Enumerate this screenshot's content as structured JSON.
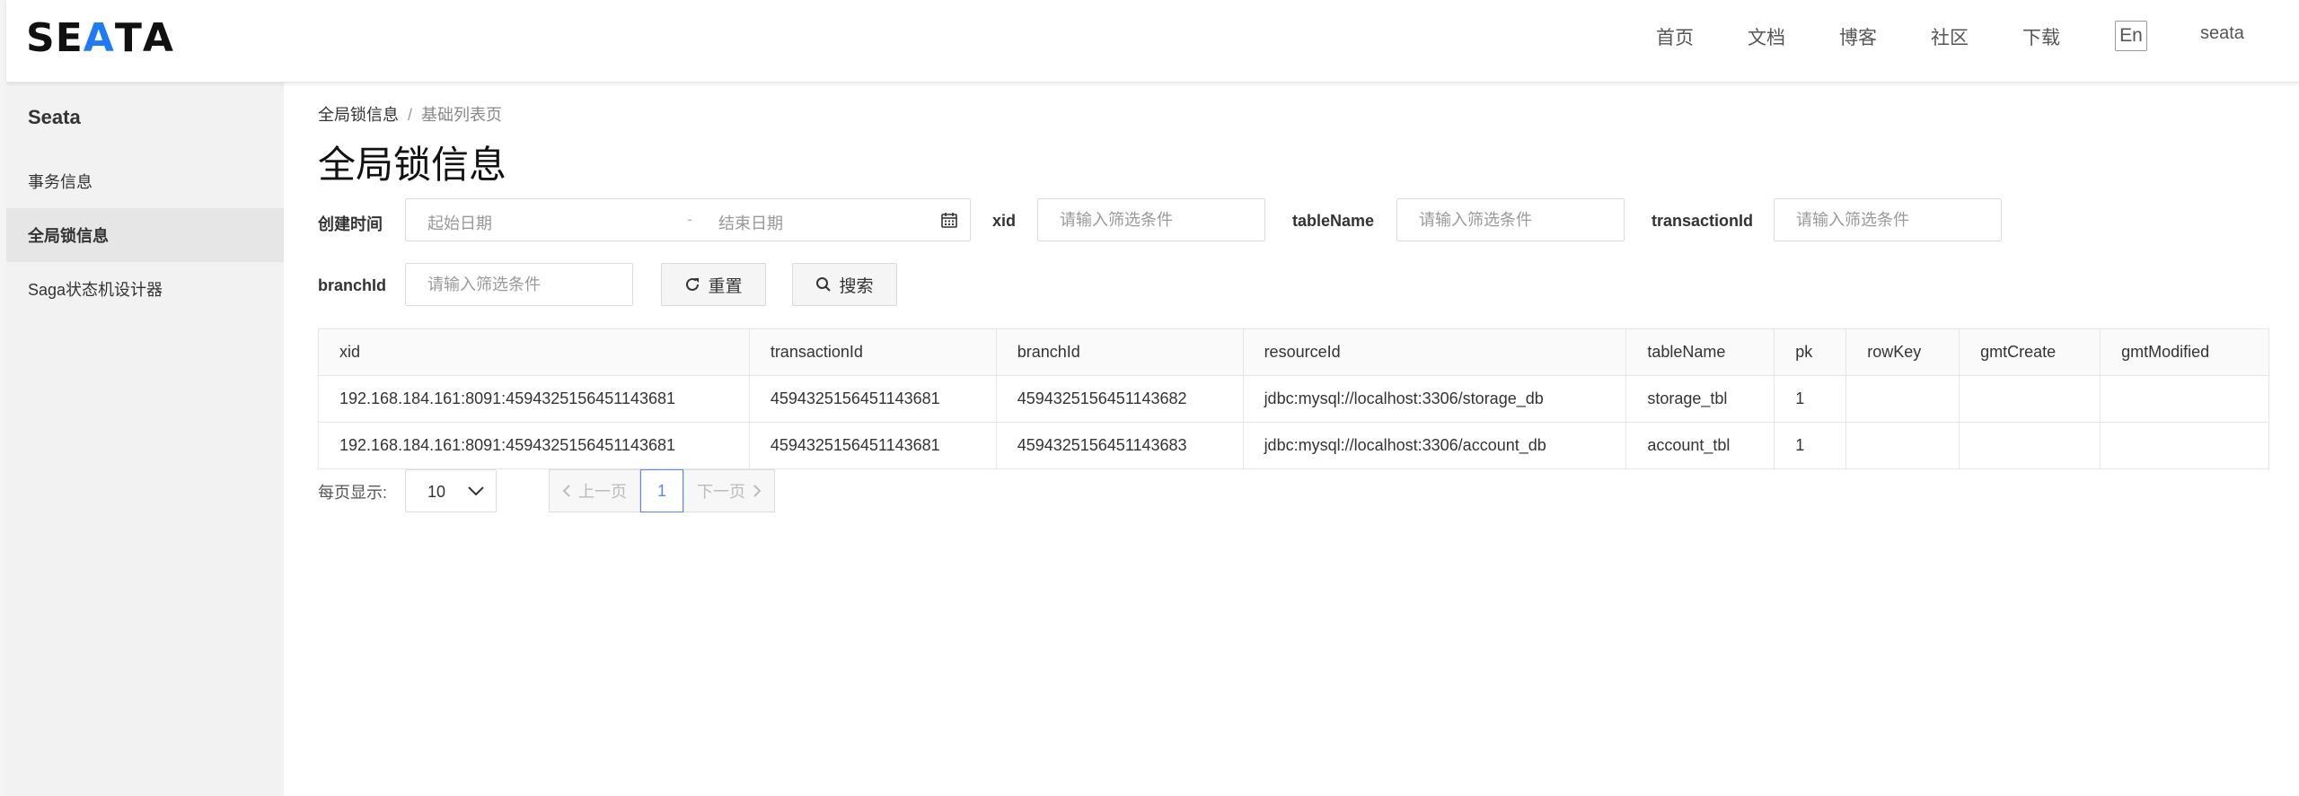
{
  "header": {
    "logo_text_1": "SE",
    "logo_text_2": "A",
    "logo_text_3": "T",
    "logo_text_4": "A",
    "nav": [
      "首页",
      "文档",
      "博客",
      "社区",
      "下载"
    ],
    "lang": "En",
    "user": "seata"
  },
  "sidebar": {
    "title": "Seata",
    "items": [
      {
        "label": "事务信息"
      },
      {
        "label": "全局锁信息"
      },
      {
        "label": "Saga状态机设计器"
      }
    ]
  },
  "breadcrumb": {
    "parent": "全局锁信息",
    "sep": "/",
    "current": "基础列表页"
  },
  "page_title": "全局锁信息",
  "filters": {
    "create_time_label": "创建时间",
    "start_placeholder": "起始日期",
    "dash": "-",
    "end_placeholder": "结束日期",
    "xid_label": "xid",
    "xid_placeholder": "请输入筛选条件",
    "table_name_label": "tableName",
    "table_name_placeholder": "请输入筛选条件",
    "transaction_id_label": "transactionId",
    "transaction_id_placeholder": "请输入筛选条件",
    "branch_id_label": "branchId",
    "branch_id_placeholder": "请输入筛选条件",
    "reset_label": "重置",
    "search_label": "搜索"
  },
  "table": {
    "columns": [
      "xid",
      "transactionId",
      "branchId",
      "resourceId",
      "tableName",
      "pk",
      "rowKey",
      "gmtCreate",
      "gmtModified"
    ],
    "rows": [
      [
        "192.168.184.161:8091:4594325156451143681",
        "4594325156451143681",
        "4594325156451143682",
        "jdbc:mysql://localhost:3306/storage_db",
        "storage_tbl",
        "1",
        "",
        "",
        ""
      ],
      [
        "192.168.184.161:8091:4594325156451143681",
        "4594325156451143681",
        "4594325156451143683",
        "jdbc:mysql://localhost:3306/account_db",
        "account_tbl",
        "1",
        "",
        "",
        ""
      ]
    ]
  },
  "pagination": {
    "page_size_label": "每页显示:",
    "page_size": "10",
    "prev_label": "上一页",
    "current_page": "1",
    "next_label": "下一页"
  }
}
